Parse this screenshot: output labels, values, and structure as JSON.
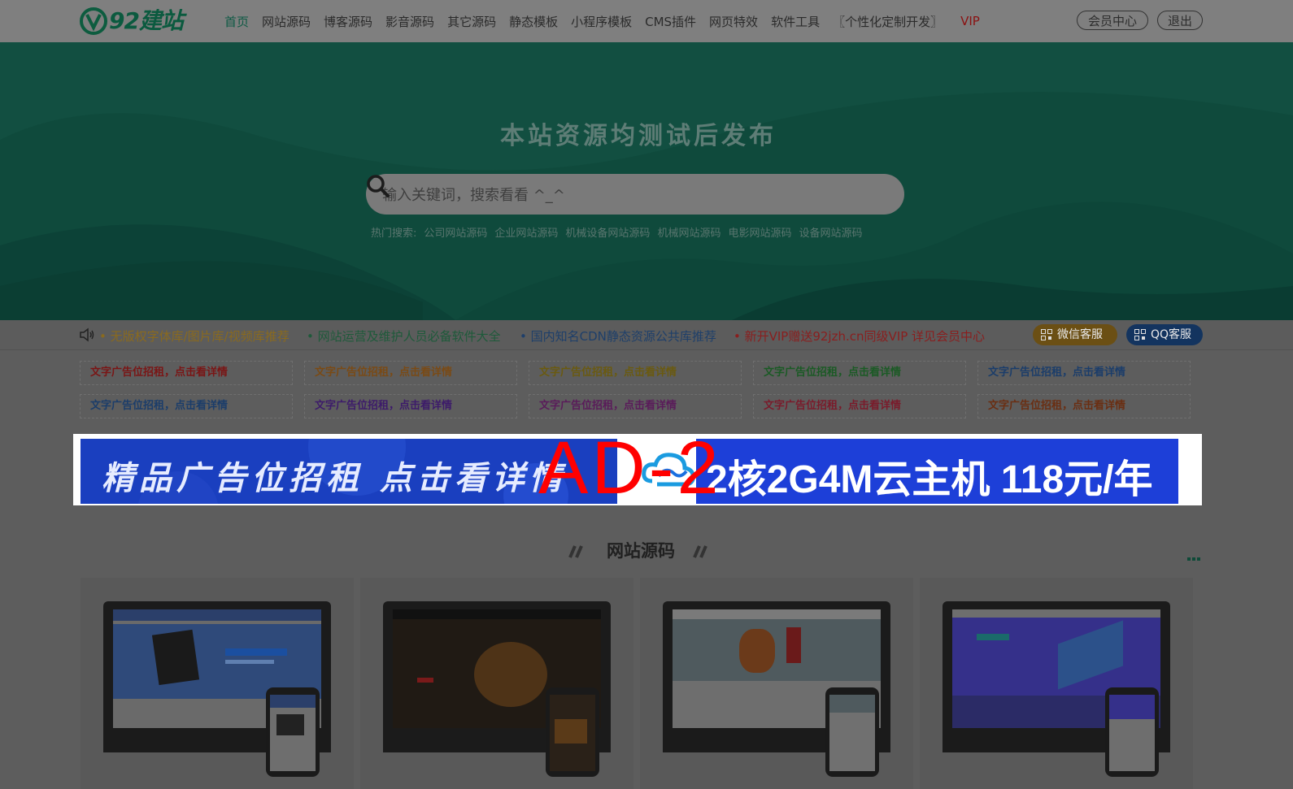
{
  "logo": {
    "text": "92建站"
  },
  "nav": {
    "items": [
      "首页",
      "网站源码",
      "博客源码",
      "影音源码",
      "其它源码",
      "静态模板",
      "小程序模板",
      "CMS插件",
      "网页特效",
      "软件工具",
      "〖个性化定制开发〗"
    ],
    "vip": "VIP",
    "member_center": "会员中心",
    "logout": "退出"
  },
  "hero": {
    "title": "本站资源均测试后发布",
    "search_placeholder": "输入关键词，搜索看看 ^_^",
    "hot_label": "热门搜索:",
    "hot_tags": [
      "公司网站源码",
      "企业网站源码",
      "机械设备网站源码",
      "机械网站源码",
      "电影网站源码",
      "设备网站源码"
    ]
  },
  "notice": {
    "items": [
      "• 无版权字体库/图片库/视频库推荐",
      "• 网站运营及维护人员必备软件大全",
      "• 国内知名CDN静态资源公共库推荐",
      "• 新开VIP赠送92jzh.cn同级VIP 详见会员中心"
    ],
    "wechat": "微信客服",
    "qq": "QQ客服"
  },
  "text_ads": [
    "文字广告位招租，点击看详情",
    "文字广告位招租，点击看详情",
    "文字广告位招租，点击看详情",
    "文字广告位招租，点击看详情",
    "文字广告位招租，点击看详情",
    "文字广告位招租，点击看详情",
    "文字广告位招租，点击看详情",
    "文字广告位招租，点击看详情",
    "文字广告位招租，点击看详情",
    "文字广告位招租，点击看详情"
  ],
  "banner": {
    "left_text": "精品广告位招租 点击看详情",
    "right_text": "2核2G4M云主机 118元/年",
    "ad_label": "AD-2"
  },
  "section": {
    "title": "网站源码"
  },
  "colors": {
    "notice": [
      "#8a6a1e",
      "#1e5a3a",
      "#1e3f6a",
      "#8a1e1e"
    ],
    "text_ads": [
      "#7a1515",
      "#7a4a15",
      "#6a5a10",
      "#1b5a25",
      "#1b3d6a",
      "#1b3d6a",
      "#3d1b6a",
      "#5a1b5a",
      "#7a1b2b",
      "#6a2e12"
    ]
  }
}
